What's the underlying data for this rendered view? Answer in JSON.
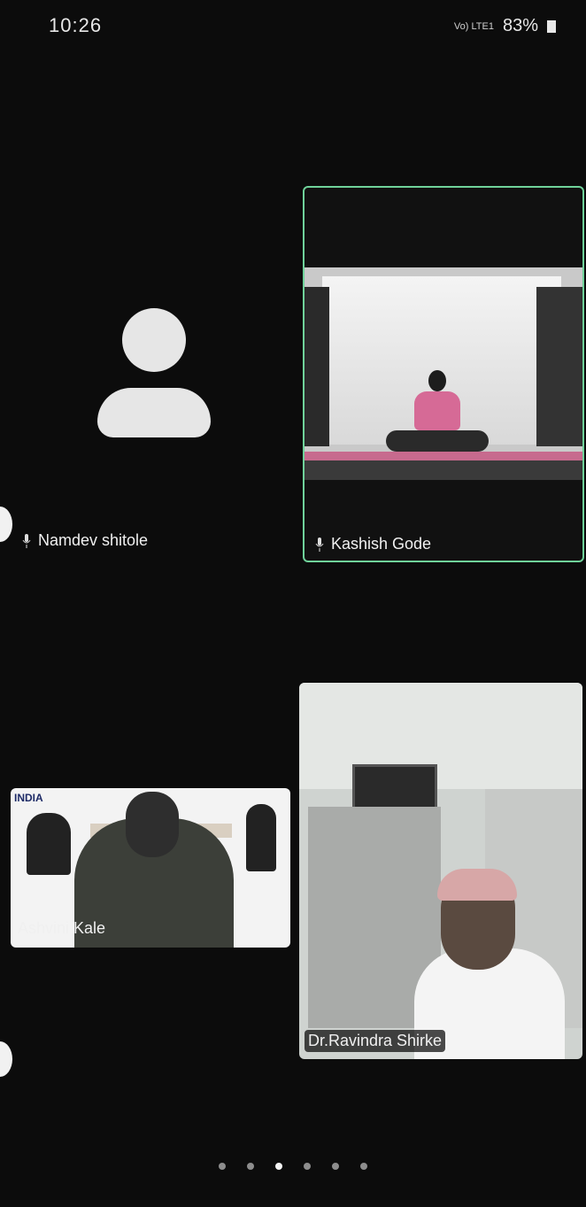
{
  "status_bar": {
    "time": "10:26",
    "signal_text": "Vo) LTE1",
    "battery": "83%"
  },
  "participants": [
    {
      "name": "Namdev shitole",
      "muted_icon": "mic-icon"
    },
    {
      "name": "Kashish Gode",
      "muted_icon": "mic-icon"
    },
    {
      "name": "Ashvini Kale"
    },
    {
      "name": "Dr.Ravindra Shirke"
    }
  ],
  "tiles": {
    "ashvini_banner": "INDIA"
  },
  "pager": {
    "pages": 6,
    "active_index": 2
  },
  "colors": {
    "active_speaker_border": "#6fd29a",
    "background": "#0c0c0c"
  }
}
